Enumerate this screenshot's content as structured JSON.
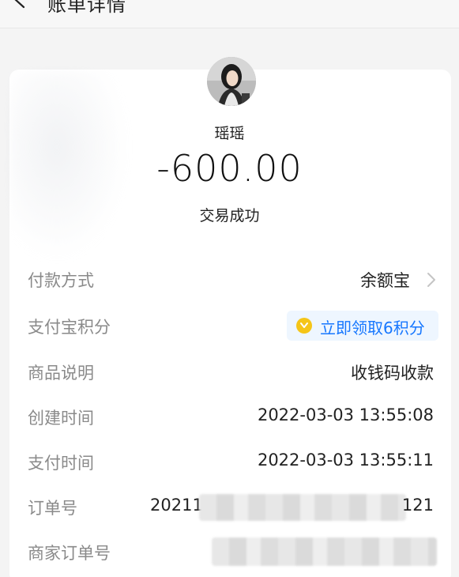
{
  "header": {
    "title": "账单详情"
  },
  "payee": {
    "name": "瑶瑶"
  },
  "transaction": {
    "amount": "-600.00",
    "status": "交易成功"
  },
  "rows": [
    {
      "label": "付款方式",
      "value": "余额宝"
    },
    {
      "label": "支付宝积分",
      "value": "立即领取6积分"
    },
    {
      "label": "商品说明",
      "value": "收钱码收款"
    },
    {
      "label": "创建时间",
      "value": "2022-03-03 13:55:08"
    },
    {
      "label": "支付时间",
      "value": "2022-03-03 13:55:11"
    },
    {
      "label": "订单号",
      "value_prefix": "20211",
      "value_suffix": "121"
    },
    {
      "label": "商家订单号"
    }
  ],
  "colors": {
    "accent_blue": "#1677ff",
    "points_pill_bg": "#eef6ff",
    "coin_yellow": "#f5c518",
    "label_gray": "#8a8a8a",
    "page_bg": "#f4f4f4",
    "card_bg": "#ffffff"
  },
  "icons": {
    "back": "chevron-left-icon",
    "arrow": "chevron-right-icon",
    "points": "coin-icon"
  }
}
